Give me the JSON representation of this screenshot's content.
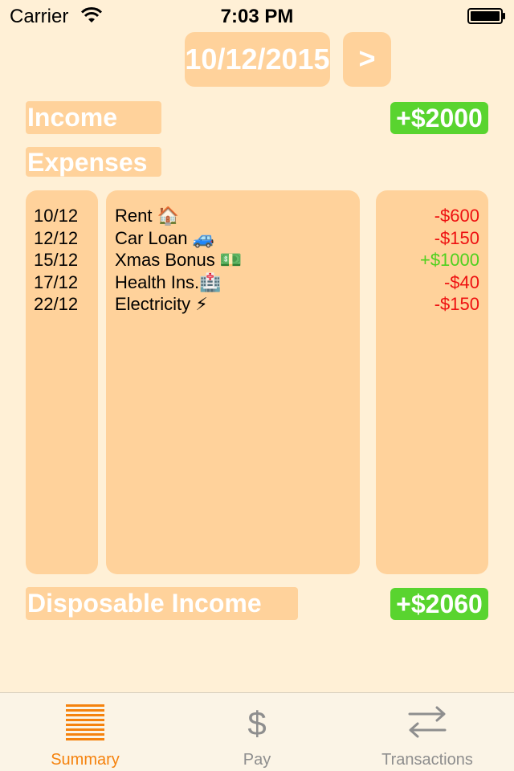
{
  "status_bar": {
    "carrier": "Carrier",
    "time": "7:03 PM"
  },
  "header": {
    "date": "10/12/2015",
    "next_label": ">"
  },
  "income": {
    "label": "Income",
    "value": "+$2000"
  },
  "expenses": {
    "label": "Expenses",
    "items": [
      {
        "date": "10/12",
        "description": "Rent 🏠",
        "amount": "-$600",
        "type": "negative"
      },
      {
        "date": "12/12",
        "description": "Car Loan 🚙",
        "amount": "-$150",
        "type": "negative"
      },
      {
        "date": "15/12",
        "description": "Xmas Bonus 💵",
        "amount": "+$1000",
        "type": "positive"
      },
      {
        "date": "17/12",
        "description": "Health Ins.🏥",
        "amount": "-$40",
        "type": "negative"
      },
      {
        "date": "22/12",
        "description": "Electricity ⚡",
        "amount": "-$150",
        "type": "negative"
      }
    ]
  },
  "disposable": {
    "label": "Disposable Income",
    "value": "+$2060"
  },
  "tab_bar": {
    "tabs": [
      {
        "label": "Summary",
        "icon": "list-lines-icon",
        "active": true
      },
      {
        "label": "Pay",
        "icon": "dollar-icon",
        "active": false
      },
      {
        "label": "Transactions",
        "icon": "swap-arrows-icon",
        "active": false
      }
    ]
  },
  "colors": {
    "background": "#fff0d6",
    "panel": "#ffd29b",
    "badge_green": "#59d42f",
    "negative": "#ee1111",
    "positive": "#4fd11e",
    "accent": "#f5820d"
  }
}
